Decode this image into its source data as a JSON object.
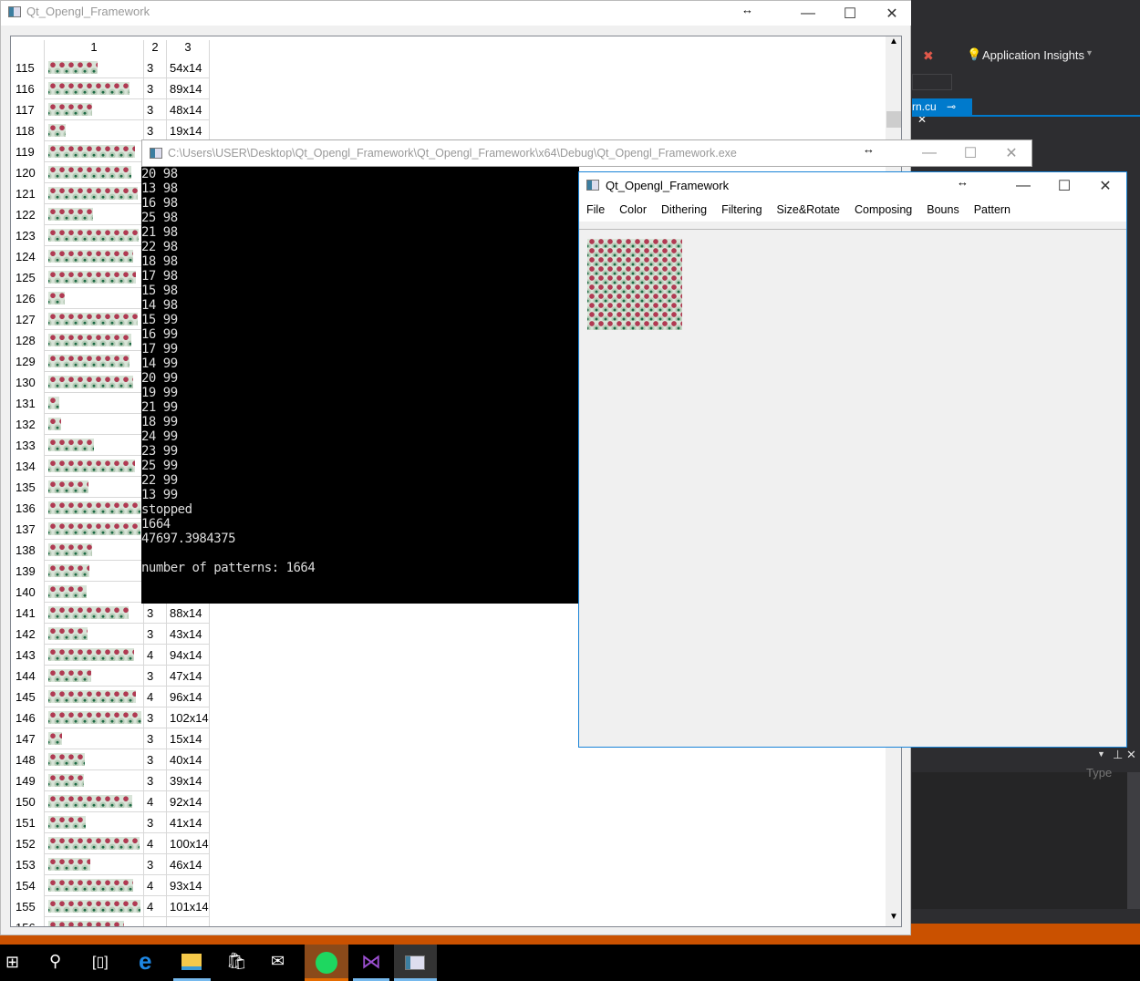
{
  "main_window": {
    "title": "Qt_Opengl_Framework",
    "table": {
      "headers": [
        "1",
        "2",
        "3"
      ],
      "rows": [
        {
          "n": "115",
          "c2": "3",
          "c3": "54x14"
        },
        {
          "n": "116",
          "c2": "3",
          "c3": "89x14"
        },
        {
          "n": "117",
          "c2": "3",
          "c3": "48x14"
        },
        {
          "n": "118",
          "c2": "3",
          "c3": "19x14"
        },
        {
          "n": "119"
        },
        {
          "n": "120"
        },
        {
          "n": "121"
        },
        {
          "n": "122"
        },
        {
          "n": "123"
        },
        {
          "n": "124"
        },
        {
          "n": "125"
        },
        {
          "n": "126"
        },
        {
          "n": "127"
        },
        {
          "n": "128"
        },
        {
          "n": "129"
        },
        {
          "n": "130"
        },
        {
          "n": "131"
        },
        {
          "n": "132"
        },
        {
          "n": "133"
        },
        {
          "n": "134"
        },
        {
          "n": "135"
        },
        {
          "n": "136"
        },
        {
          "n": "137"
        },
        {
          "n": "138"
        },
        {
          "n": "139"
        },
        {
          "n": "140"
        },
        {
          "n": "141",
          "c2": "3",
          "c3": "88x14"
        },
        {
          "n": "142",
          "c2": "3",
          "c3": "43x14"
        },
        {
          "n": "143",
          "c2": "4",
          "c3": "94x14"
        },
        {
          "n": "144",
          "c2": "3",
          "c3": "47x14"
        },
        {
          "n": "145",
          "c2": "4",
          "c3": "96x14"
        },
        {
          "n": "146",
          "c2": "3",
          "c3": "102x14"
        },
        {
          "n": "147",
          "c2": "3",
          "c3": "15x14"
        },
        {
          "n": "148",
          "c2": "3",
          "c3": "40x14"
        },
        {
          "n": "149",
          "c2": "3",
          "c3": "39x14"
        },
        {
          "n": "150",
          "c2": "4",
          "c3": "92x14"
        },
        {
          "n": "151",
          "c2": "3",
          "c3": "41x14"
        },
        {
          "n": "152",
          "c2": "4",
          "c3": "100x14"
        },
        {
          "n": "153",
          "c2": "3",
          "c3": "46x14"
        },
        {
          "n": "154",
          "c2": "4",
          "c3": "93x14"
        },
        {
          "n": "155",
          "c2": "4",
          "c3": "101x14"
        }
      ]
    }
  },
  "console_window": {
    "title": "C:\\Users\\USER\\Desktop\\Qt_Opengl_Framework\\Qt_Opengl_Framework\\x64\\Debug\\Qt_Opengl_Framework.exe",
    "lines": [
      "20 98",
      "13 98",
      "16 98",
      "25 98",
      "21 98",
      "22 98",
      "18 98",
      "17 98",
      "15 98",
      "14 98",
      "15 99",
      "16 99",
      "17 99",
      "14 99",
      "20 99",
      "19 99",
      "21 99",
      "18 99",
      "24 99",
      "23 99",
      "25 99",
      "22 99",
      "13 99",
      "stopped",
      "1664",
      "47697.3984375",
      "",
      "number of patterns: 1664"
    ]
  },
  "qt_window": {
    "title": "Qt_Opengl_Framework",
    "menu": [
      "File",
      "Color",
      "Dithering",
      "Filtering",
      "Size&Rotate",
      "Composing",
      "Bouns",
      "Pattern"
    ]
  },
  "vs": {
    "app_insights": "Application Insights",
    "tab": "rn.cu",
    "column_type": "Type",
    "accent": "#007acc",
    "status_color": "#ca5100"
  },
  "taskbar": {
    "icons": [
      "windows-start-icon",
      "search-icon",
      "task-view-icon",
      "edge-icon",
      "file-explorer-icon",
      "store-icon",
      "mail-icon",
      "spotify-icon",
      "visual-studio-icon",
      "qt-app-icon"
    ]
  }
}
